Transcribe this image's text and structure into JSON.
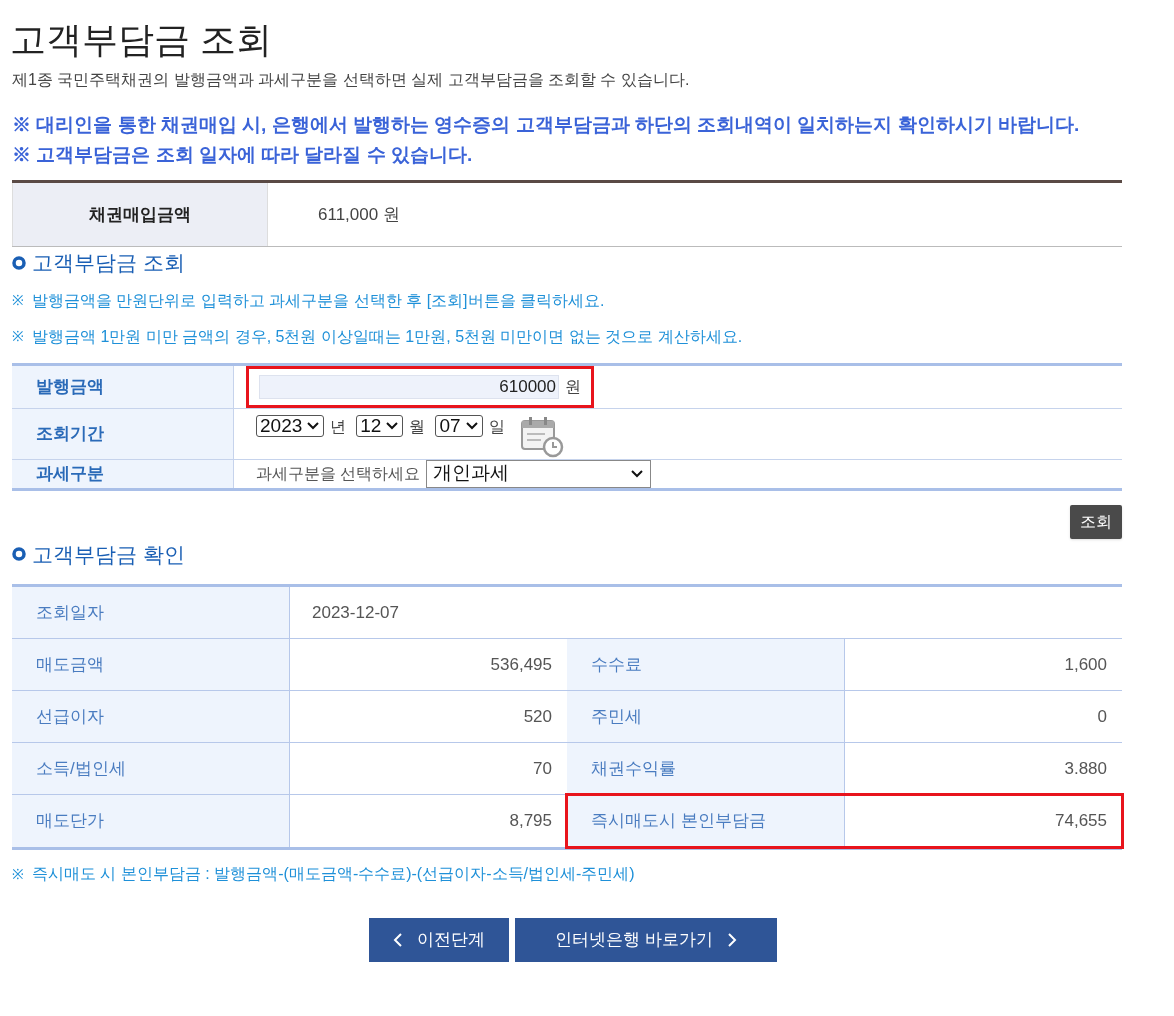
{
  "title": "고객부담금 조회",
  "description": "제1종 국민주택채권의 발행금액과 과세구분을 선택하면 실제 고객부담금을 조회할 수 있습니다.",
  "notices": [
    "※ 대리인을 통한 채권매입 시, 은행에서 발행하는 영수증의 고객부담금과 하단의 조회내역이 일치하는지 확인하시기 바랍니다.",
    "※ 고객부담금은 조회 일자에 따라 달라질 수 있습니다."
  ],
  "purchase": {
    "label": "채권매입금액",
    "value": "611,000 원"
  },
  "inquiry": {
    "heading": "고객부담금 조회",
    "notes": [
      {
        "mark": "※",
        "text": "발행금액을 만원단위로 입력하고 과세구분을 선택한 후 [조회]버튼을 클릭하세요."
      },
      {
        "mark": "※",
        "text": "발행금액 1만원 미만 금액의 경우, 5천원 이상일때는 1만원, 5천원 미만이면 없는 것으로 계산하세요."
      }
    ],
    "amount": {
      "label": "발행금액",
      "value": "610000",
      "unit": "원",
      "highlighted": true
    },
    "period": {
      "label": "조회기간",
      "year": "2023",
      "year_unit": "년",
      "month": "12",
      "month_unit": "월",
      "day": "07",
      "day_unit": "일"
    },
    "tax": {
      "label": "과세구분",
      "prompt": "과세구분을 선택하세요",
      "value": "개인과세"
    },
    "search_button": "조회"
  },
  "result": {
    "heading": "고객부담금 확인",
    "date": {
      "label": "조회일자",
      "value": "2023-12-07"
    },
    "rows": [
      {
        "label": "매도금액",
        "value": "536,495",
        "label_2": "수수료",
        "value_2": "1,600",
        "highlighted": false
      },
      {
        "label": "선급이자",
        "value": "520",
        "label_2": "주민세",
        "value_2": "0",
        "highlighted": false
      },
      {
        "label": "소득/법인세",
        "value": "70",
        "label_2": "채권수익률",
        "value_2": "3.880",
        "highlighted": false
      },
      {
        "label": "매도단가",
        "value": "8,795",
        "label_2": "즉시매도시 본인부담금",
        "value_2": "74,655",
        "highlighted": true
      }
    ],
    "formula": {
      "mark": "※",
      "text": "즉시매도 시 본인부담금 : 발행금액-(매도금액-수수료)-(선급이자-소득/법인세-주민세)"
    }
  },
  "buttons": [
    {
      "label": "이전단계",
      "kind": "prev"
    },
    {
      "label": "인터넷은행 바로가기",
      "kind": "next"
    }
  ]
}
